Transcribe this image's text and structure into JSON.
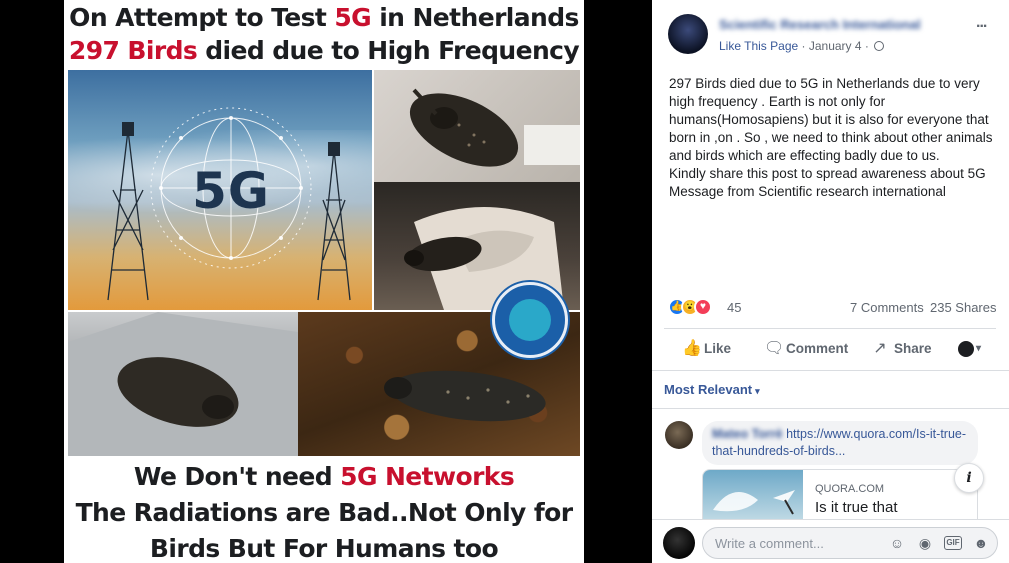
{
  "poster": {
    "headline_line1_prefix": "On Attempt to Test ",
    "headline_line1_accent": "5G",
    "headline_line1_suffix": " in Netherlands",
    "headline_line2_accent": "297 Birds",
    "headline_line2_suffix": " died due to High Frequency",
    "center_label": "5G",
    "footer_line1_prefix": "We Don't need ",
    "footer_line1_accent": "5G Networks",
    "footer_line2": "The Radiations are Bad..Not Only for",
    "footer_line3": "Birds But For Humans too",
    "accent_color": "#c8102e"
  },
  "post": {
    "page_name": "Scientific Research International",
    "meta_link": "Like This Page",
    "meta_separator": " · ",
    "date": "January 4",
    "meta_dot": " · ",
    "more_icon": "...",
    "body_lines": [
      "297 Birds died due to 5G in Netherlands due to very high frequency . Earth is not only for humans(Homosapiens) but it is also for everyone that born in ,on . So , we need to think about other animals and birds which are effecting badly due to us.",
      "Kindly share this post to spread awareness about 5G",
      "Message from Scientific research international"
    ],
    "reaction_count": "45",
    "comments_count": "7 Comments",
    "shares_count": "235 Shares",
    "reaction_glyphs": {
      "like": "👍",
      "wow": "😮",
      "love": "♥"
    },
    "brand_color": "#385898"
  },
  "actions": {
    "like_label": "Like",
    "comment_label": "Comment",
    "share_label": "Share",
    "like_icon": "👍",
    "comment_icon": "🗨",
    "share_icon": "↗",
    "caret": "▾"
  },
  "comments": {
    "sort_label": "Most Relevant",
    "first_commenter": "Mateo Torrè",
    "first_comment_link": "https://www.quora.com/Is-it-true-that-hundreds-of-birds...",
    "preview_domain": "QUORA.COM",
    "preview_title": "Is it true that",
    "info_label": "i"
  },
  "composer": {
    "placeholder": "Write a comment...",
    "emoji_icon": "☺",
    "camera_icon": "◉",
    "gif_label": "GIF",
    "sticker_icon": "☻"
  }
}
